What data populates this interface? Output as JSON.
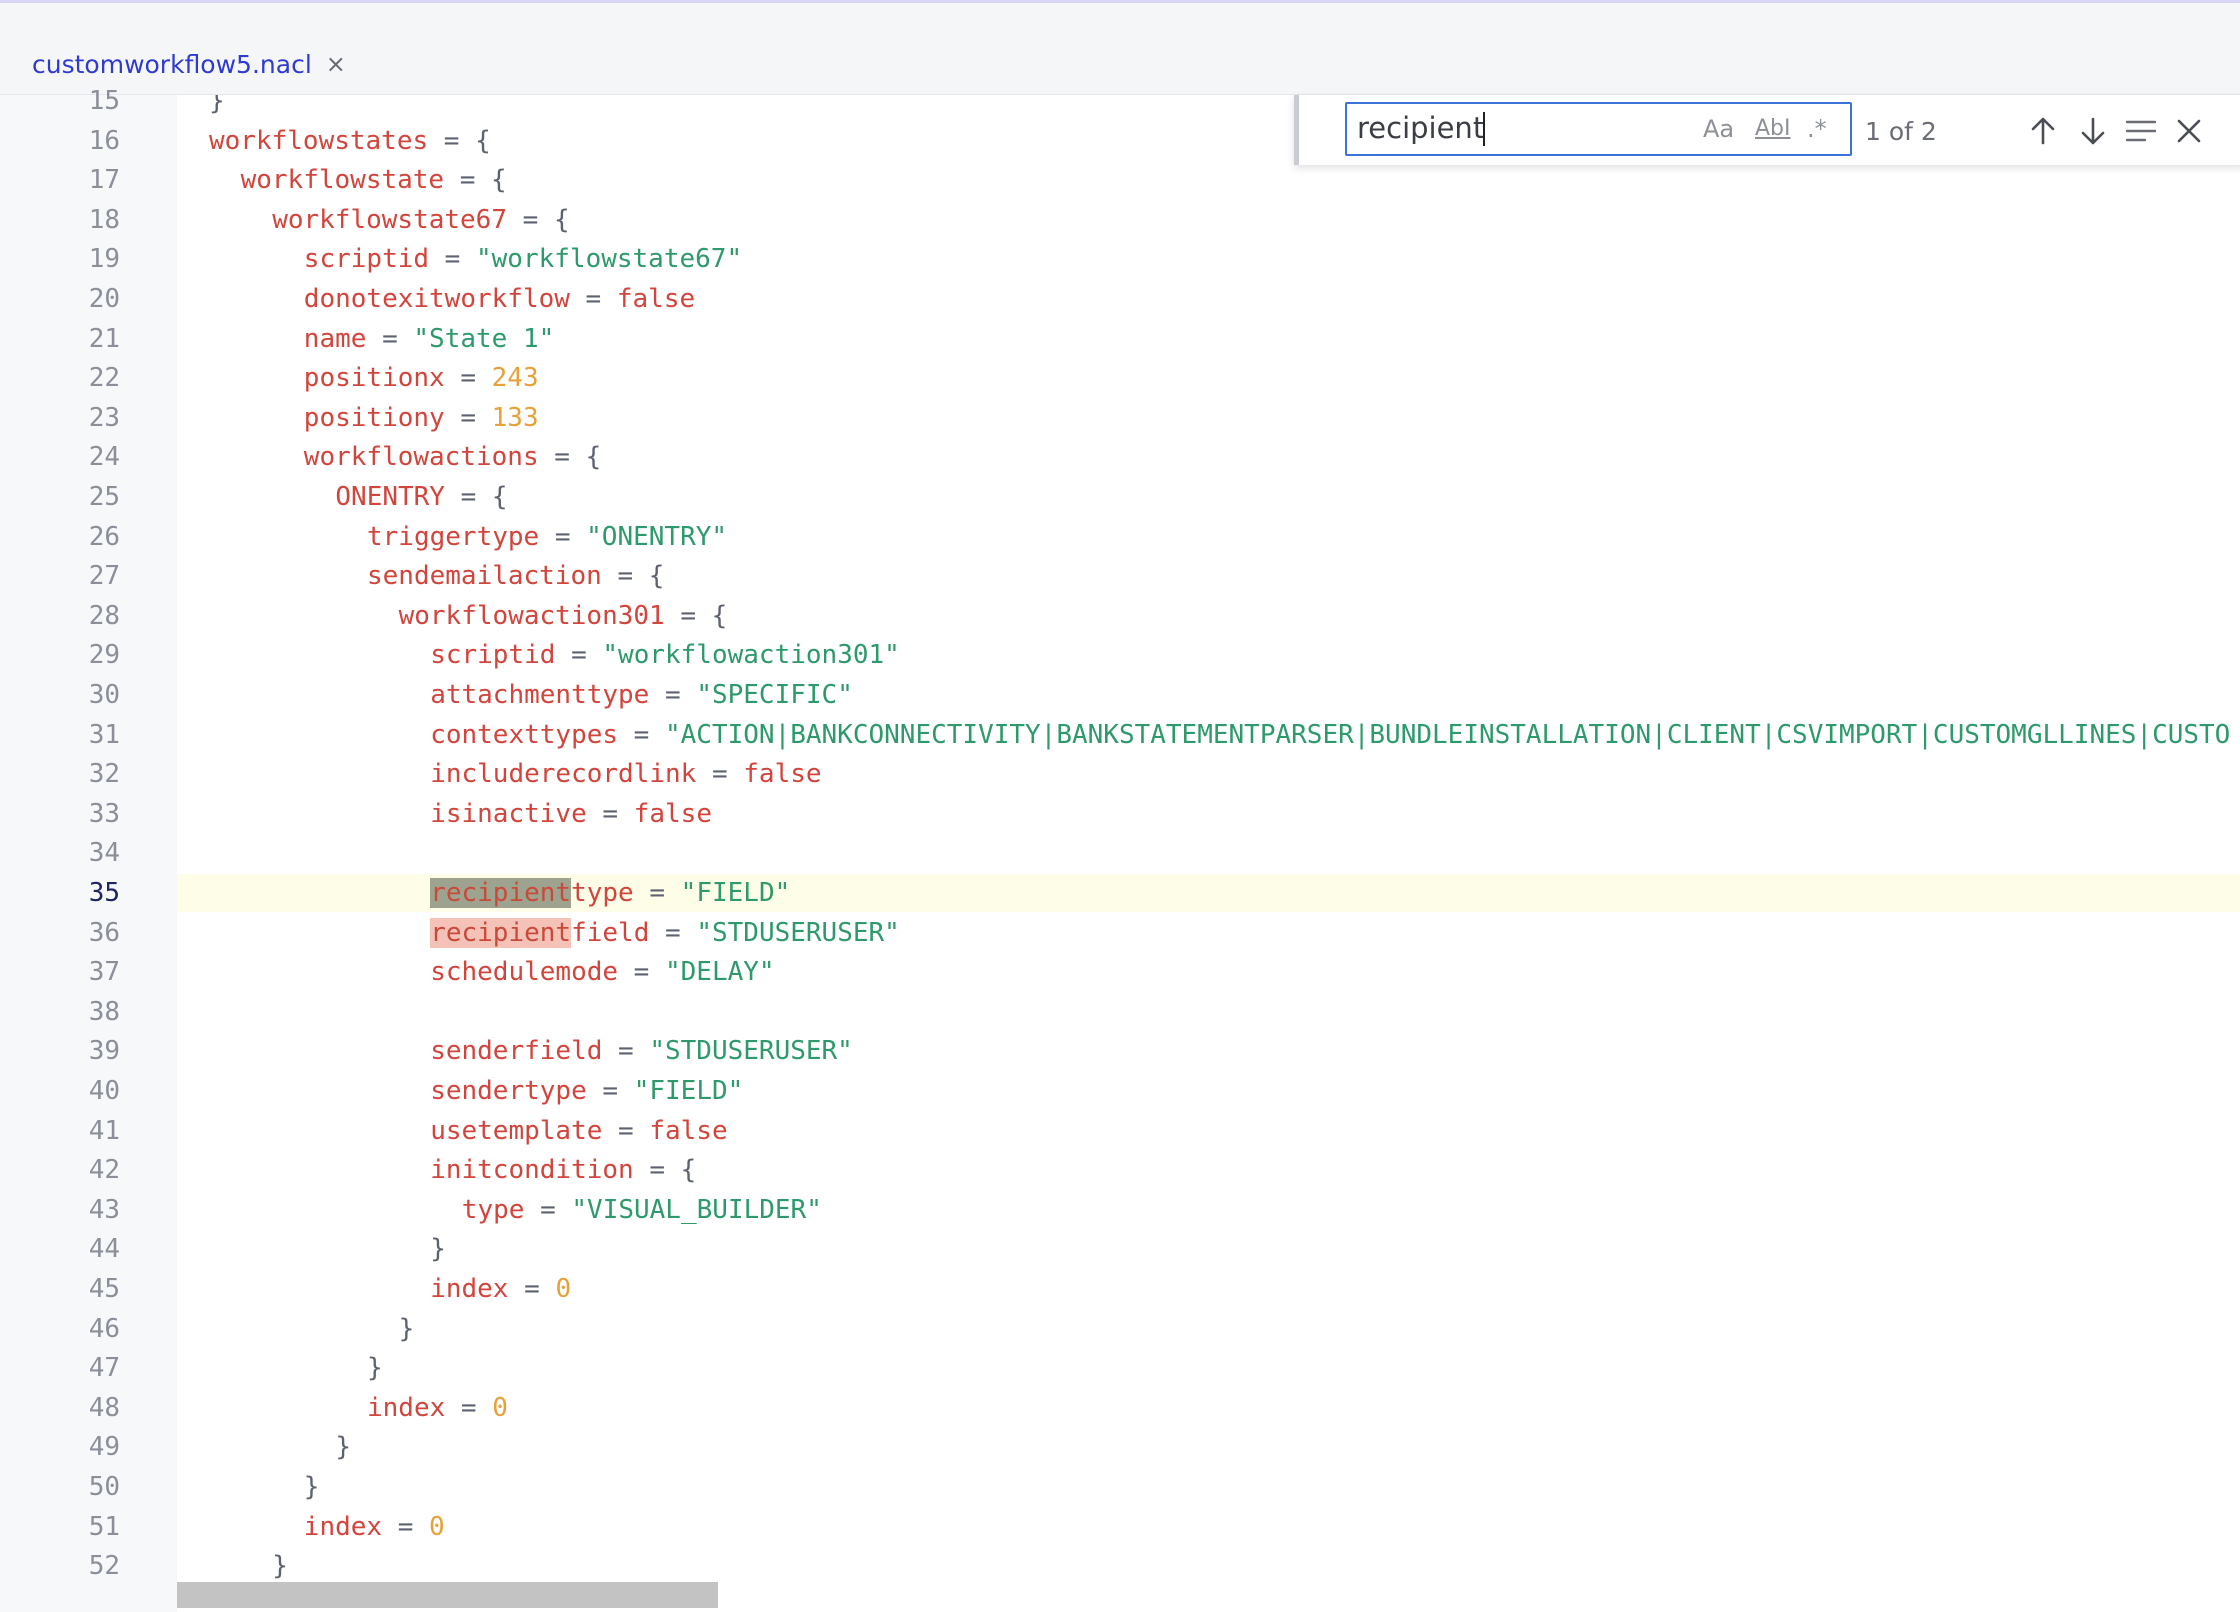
{
  "tab": {
    "filename": "customworkflow5.nacl",
    "close_symbol": "×"
  },
  "find": {
    "query": "recipient",
    "match_case_label": "Aa",
    "whole_word_label": "AbI",
    "regex_label": ".*",
    "match_count": "1 of 2",
    "icons": [
      "arrow-up-icon",
      "arrow-down-icon",
      "find-in-selection-icon",
      "close-icon"
    ]
  },
  "editor": {
    "active_line": "35",
    "line_numbers": [
      "15",
      "16",
      "17",
      "18",
      "19",
      "20",
      "21",
      "22",
      "23",
      "24",
      "25",
      "26",
      "27",
      "28",
      "29",
      "30",
      "31",
      "32",
      "33",
      "34",
      "35",
      "36",
      "37",
      "38",
      "39",
      "40",
      "41",
      "42",
      "43",
      "44",
      "45",
      "46",
      "47",
      "48",
      "49",
      "50",
      "51",
      "52"
    ],
    "lines": [
      {
        "indent": 0,
        "tokens": [
          {
            "t": "}",
            "c": "o"
          }
        ]
      },
      {
        "indent": 0,
        "tokens": [
          {
            "t": "workflowstates",
            "c": "k"
          },
          {
            "t": " = {",
            "c": "o"
          }
        ]
      },
      {
        "indent": 1,
        "tokens": [
          {
            "t": "workflowstate",
            "c": "k"
          },
          {
            "t": " = {",
            "c": "o"
          }
        ]
      },
      {
        "indent": 2,
        "tokens": [
          {
            "t": "workflowstate67",
            "c": "k"
          },
          {
            "t": " = {",
            "c": "o"
          }
        ]
      },
      {
        "indent": 3,
        "tokens": [
          {
            "t": "scriptid",
            "c": "k"
          },
          {
            "t": " = ",
            "c": "o"
          },
          {
            "t": "\"workflowstate67\"",
            "c": "s"
          }
        ]
      },
      {
        "indent": 3,
        "tokens": [
          {
            "t": "donotexitworkflow",
            "c": "k"
          },
          {
            "t": " = ",
            "c": "o"
          },
          {
            "t": "false",
            "c": "k"
          }
        ]
      },
      {
        "indent": 3,
        "tokens": [
          {
            "t": "name",
            "c": "k"
          },
          {
            "t": " = ",
            "c": "o"
          },
          {
            "t": "\"State 1\"",
            "c": "s"
          }
        ]
      },
      {
        "indent": 3,
        "tokens": [
          {
            "t": "positionx",
            "c": "k"
          },
          {
            "t": " = ",
            "c": "o"
          },
          {
            "t": "243",
            "c": "n"
          }
        ]
      },
      {
        "indent": 3,
        "tokens": [
          {
            "t": "positiony",
            "c": "k"
          },
          {
            "t": " = ",
            "c": "o"
          },
          {
            "t": "133",
            "c": "n"
          }
        ]
      },
      {
        "indent": 3,
        "tokens": [
          {
            "t": "workflowactions",
            "c": "k"
          },
          {
            "t": " = {",
            "c": "o"
          }
        ]
      },
      {
        "indent": 4,
        "tokens": [
          {
            "t": "ONENTRY",
            "c": "k"
          },
          {
            "t": " = {",
            "c": "o"
          }
        ]
      },
      {
        "indent": 5,
        "tokens": [
          {
            "t": "triggertype",
            "c": "k"
          },
          {
            "t": " = ",
            "c": "o"
          },
          {
            "t": "\"ONENTRY\"",
            "c": "s"
          }
        ]
      },
      {
        "indent": 5,
        "tokens": [
          {
            "t": "sendemailaction",
            "c": "k"
          },
          {
            "t": " = {",
            "c": "o"
          }
        ]
      },
      {
        "indent": 6,
        "tokens": [
          {
            "t": "workflowaction301",
            "c": "k"
          },
          {
            "t": " = {",
            "c": "o"
          }
        ]
      },
      {
        "indent": 7,
        "tokens": [
          {
            "t": "scriptid",
            "c": "k"
          },
          {
            "t": " = ",
            "c": "o"
          },
          {
            "t": "\"workflowaction301\"",
            "c": "s"
          }
        ]
      },
      {
        "indent": 7,
        "tokens": [
          {
            "t": "attachmenttype",
            "c": "k"
          },
          {
            "t": " = ",
            "c": "o"
          },
          {
            "t": "\"SPECIFIC\"",
            "c": "s"
          }
        ]
      },
      {
        "indent": 7,
        "tokens": [
          {
            "t": "contexttypes",
            "c": "k"
          },
          {
            "t": " = ",
            "c": "o"
          },
          {
            "t": "\"ACTION|BANKCONNECTIVITY|BANKSTATEMENTPARSER|BUNDLEINSTALLATION|CLIENT|CSVIMPORT|CUSTOMGLLINES|CUSTO",
            "c": "s"
          }
        ]
      },
      {
        "indent": 7,
        "tokens": [
          {
            "t": "includerecordlink",
            "c": "k"
          },
          {
            "t": " = ",
            "c": "o"
          },
          {
            "t": "false",
            "c": "k"
          }
        ]
      },
      {
        "indent": 7,
        "tokens": [
          {
            "t": "isinactive",
            "c": "k"
          },
          {
            "t": " = ",
            "c": "o"
          },
          {
            "t": "false",
            "c": "k"
          }
        ]
      },
      {
        "indent": 0,
        "tokens": []
      },
      {
        "indent": 7,
        "tokens": [
          {
            "t": "recipient",
            "c": "hl-current"
          },
          {
            "t": "type",
            "c": "k"
          },
          {
            "t": " = ",
            "c": "o"
          },
          {
            "t": "\"FIELD\"",
            "c": "s"
          }
        ]
      },
      {
        "indent": 7,
        "tokens": [
          {
            "t": "recipient",
            "c": "hl-other"
          },
          {
            "t": "field",
            "c": "k"
          },
          {
            "t": " = ",
            "c": "o"
          },
          {
            "t": "\"STDUSERUSER\"",
            "c": "s"
          }
        ]
      },
      {
        "indent": 7,
        "tokens": [
          {
            "t": "schedulemode",
            "c": "k"
          },
          {
            "t": " = ",
            "c": "o"
          },
          {
            "t": "\"DELAY\"",
            "c": "s"
          }
        ]
      },
      {
        "indent": 0,
        "tokens": []
      },
      {
        "indent": 7,
        "tokens": [
          {
            "t": "senderfield",
            "c": "k"
          },
          {
            "t": " = ",
            "c": "o"
          },
          {
            "t": "\"STDUSERUSER\"",
            "c": "s"
          }
        ]
      },
      {
        "indent": 7,
        "tokens": [
          {
            "t": "sendertype",
            "c": "k"
          },
          {
            "t": " = ",
            "c": "o"
          },
          {
            "t": "\"FIELD\"",
            "c": "s"
          }
        ]
      },
      {
        "indent": 7,
        "tokens": [
          {
            "t": "usetemplate",
            "c": "k"
          },
          {
            "t": " = ",
            "c": "o"
          },
          {
            "t": "false",
            "c": "k"
          }
        ]
      },
      {
        "indent": 7,
        "tokens": [
          {
            "t": "initcondition",
            "c": "k"
          },
          {
            "t": " = {",
            "c": "o"
          }
        ]
      },
      {
        "indent": 8,
        "tokens": [
          {
            "t": "type",
            "c": "k"
          },
          {
            "t": " = ",
            "c": "o"
          },
          {
            "t": "\"VISUAL_BUILDER\"",
            "c": "s"
          }
        ]
      },
      {
        "indent": 7,
        "tokens": [
          {
            "t": "}",
            "c": "o"
          }
        ]
      },
      {
        "indent": 7,
        "tokens": [
          {
            "t": "index",
            "c": "k"
          },
          {
            "t": " = ",
            "c": "o"
          },
          {
            "t": "0",
            "c": "n"
          }
        ]
      },
      {
        "indent": 6,
        "tokens": [
          {
            "t": "}",
            "c": "o"
          }
        ]
      },
      {
        "indent": 5,
        "tokens": [
          {
            "t": "}",
            "c": "o"
          }
        ]
      },
      {
        "indent": 5,
        "tokens": [
          {
            "t": "index",
            "c": "k"
          },
          {
            "t": " = ",
            "c": "o"
          },
          {
            "t": "0",
            "c": "n"
          }
        ]
      },
      {
        "indent": 4,
        "tokens": [
          {
            "t": "}",
            "c": "o"
          }
        ]
      },
      {
        "indent": 3,
        "tokens": [
          {
            "t": "}",
            "c": "o"
          }
        ]
      },
      {
        "indent": 3,
        "tokens": [
          {
            "t": "index",
            "c": "k"
          },
          {
            "t": " = ",
            "c": "o"
          },
          {
            "t": "0",
            "c": "n"
          }
        ]
      },
      {
        "indent": 2,
        "tokens": [
          {
            "t": "}",
            "c": "o"
          }
        ]
      }
    ]
  }
}
